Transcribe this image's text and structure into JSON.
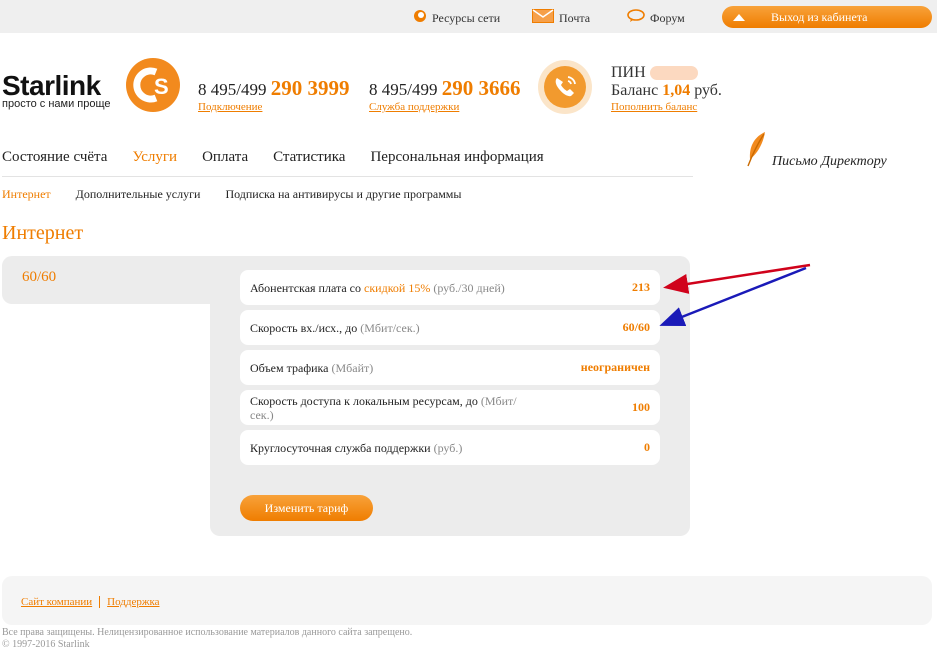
{
  "topbar": {
    "resources": "Ресурсы сети",
    "mail": "Почта",
    "forum": "Форум",
    "exit": "Выход из кабинета"
  },
  "header": {
    "logo_text": "Starlink",
    "logo_sub": "просто с нами проще",
    "phone1_prefix": "8 495/499",
    "phone1_number": "290 3999",
    "phone1_label": "Подключение",
    "phone2_prefix": "8 495/499",
    "phone2_number": "290 3666",
    "phone2_label": "Служба поддержки",
    "pin_label": "ПИН",
    "balance_label": "Баланс",
    "balance_value": "1,04",
    "balance_unit": "руб.",
    "topup_label": "Пополнить баланс"
  },
  "mainnav": [
    "Состояние счёта",
    "Услуги",
    "Оплата",
    "Статистика",
    "Персональная информация"
  ],
  "mainnav_active": "Услуги",
  "letter_label": "Письмо Директору",
  "subnav": [
    "Интернет",
    "Дополнительные услуги",
    "Подписка на антивирусы и другие программы"
  ],
  "page_title": "Интернет",
  "tariff": {
    "name": "60/60",
    "rows": [
      {
        "label": "Абонентская плата со ",
        "highlight": "скидкой 15%",
        "unit": " (руб./30 дней)",
        "value": "213"
      },
      {
        "label": "Скорость вх./исх., до ",
        "unit": "(Мбит/сек.)",
        "value": "60/60"
      },
      {
        "label": "Объем трафика ",
        "unit": "(Мбайт)",
        "value": "неограничен"
      },
      {
        "label": "Скорость доступа к локальным ресурсам, до ",
        "unit": "(Мбит/сек.)",
        "value": "100"
      },
      {
        "label": "Круглосуточная служба поддержки ",
        "unit": "(руб.)",
        "value": "0"
      }
    ],
    "change_button": "Изменить тариф"
  },
  "footer": {
    "link1": "Сайт компании",
    "link2": "Поддержка",
    "copyright1": "Все права защищены. Нелицензированное использование материалов данного сайта запрещено.",
    "copyright2": "© 1997-2016 Starlink"
  },
  "colors": {
    "accent": "#ef7d00",
    "arrow_red": "#d0021b",
    "arrow_blue": "#1a1ab8"
  }
}
